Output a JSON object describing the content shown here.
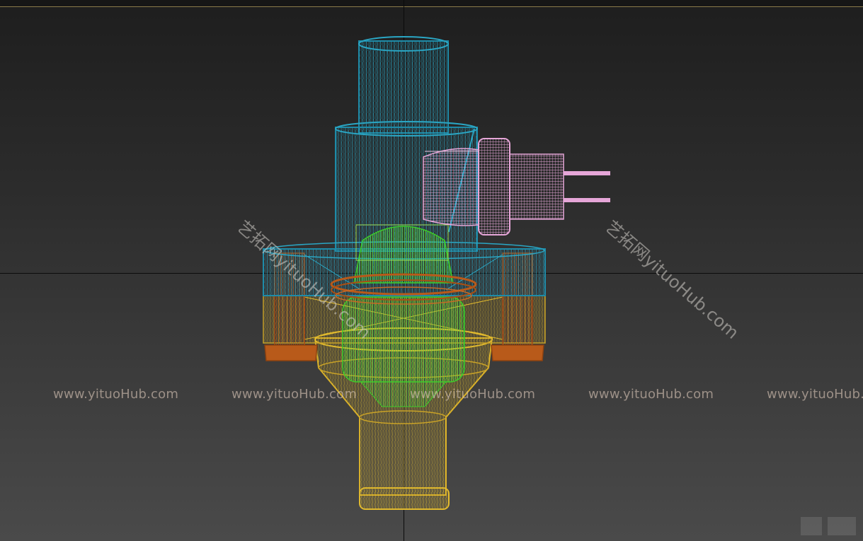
{
  "viewport": {
    "watermarks": [
      "www.yituoHub.com",
      "www.yituoHub.com",
      "www.yituoHub.com",
      "www.yituoHub.com",
      "www.yituoHub.com"
    ],
    "diagonal_watermarks": [
      "艺拓网yituoHub.com",
      "艺拓网yituoHub.com"
    ]
  },
  "colors": {
    "valve_body": "#1e8ba8",
    "inner_core": "#3ccd2a",
    "lower_body": "#c9a227",
    "bolts": "#b85a1a",
    "connector": "#e6a6d8"
  }
}
